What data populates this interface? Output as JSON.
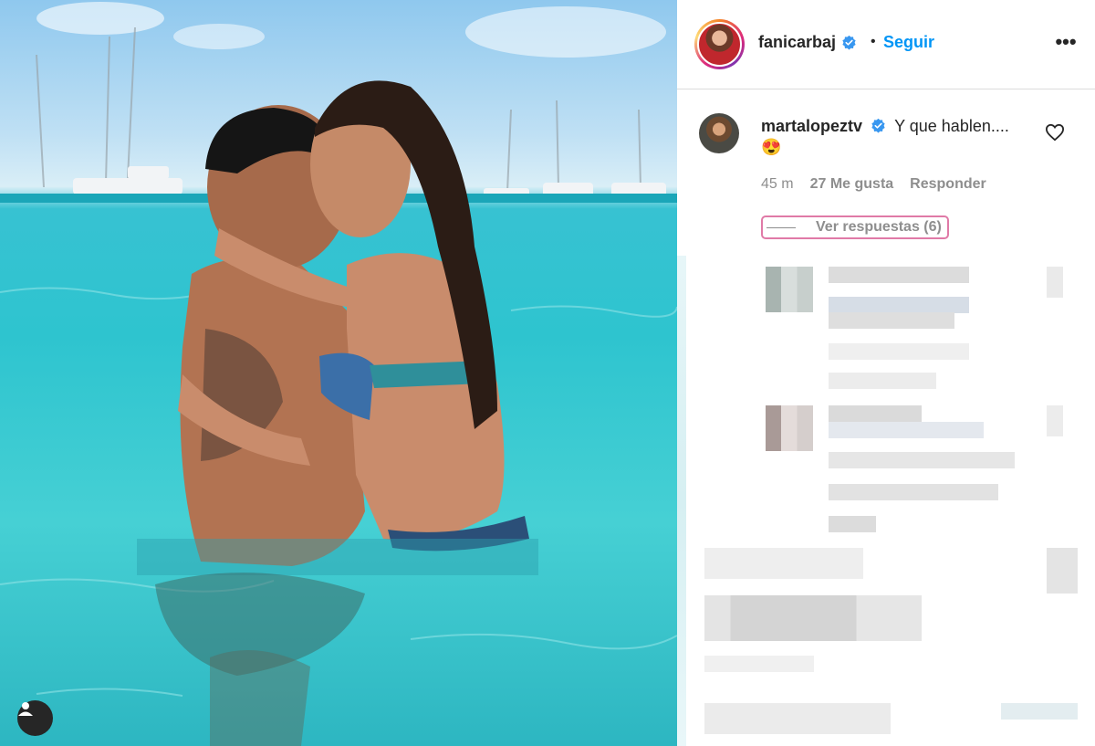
{
  "post": {
    "author": "fanicarbaj",
    "follow_label": "Seguir",
    "separator": "•",
    "more_label": "•••"
  },
  "comment": {
    "username": "martalopeztv",
    "text": "Y que hablen....",
    "emoji": "😍",
    "time": "45 m",
    "likes": "27 Me gusta",
    "reply_label": "Responder",
    "view_replies_label": "Ver respuestas (6)"
  },
  "colors": {
    "accent_blue": "#0095f6",
    "verified_blue": "#3897f0",
    "highlight_pink": "#e07aa7",
    "muted_text": "#8e8e8e"
  },
  "icons": {
    "verified": "verified-badge-icon",
    "heart": "heart-outline-icon",
    "user_tag": "user-tag-icon",
    "more": "more-options-icon"
  }
}
